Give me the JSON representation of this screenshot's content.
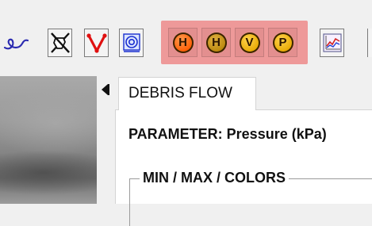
{
  "toolbar": {
    "tools": [
      {
        "icon": "curl-stroke-icon"
      },
      {
        "icon": "no-hand-cursor-icon"
      },
      {
        "icon": "red-v-icon"
      },
      {
        "icon": "target-circle-icon"
      }
    ],
    "hazard_buttons": [
      {
        "label": "H",
        "icon": "hazard-h-orange-icon",
        "color": "#ff6a00"
      },
      {
        "label": "H",
        "icon": "hazard-h-amber-icon",
        "color": "#b8860b"
      },
      {
        "label": "V",
        "icon": "hazard-v-gold-icon",
        "color": "#e6a800"
      },
      {
        "label": "P",
        "icon": "hazard-p-gold-icon",
        "color": "#e6a800"
      }
    ],
    "hazard_group_color": "#ee9999",
    "chart_tool": {
      "icon": "line-chart-icon"
    }
  },
  "splitter": {
    "icon": "collapse-left-arrow-icon"
  },
  "panel": {
    "tab_label": "DEBRIS FLOW",
    "parameter_label": "PARAMETER: Pressure (kPa)",
    "group_title": "MIN / MAX / COLORS"
  }
}
